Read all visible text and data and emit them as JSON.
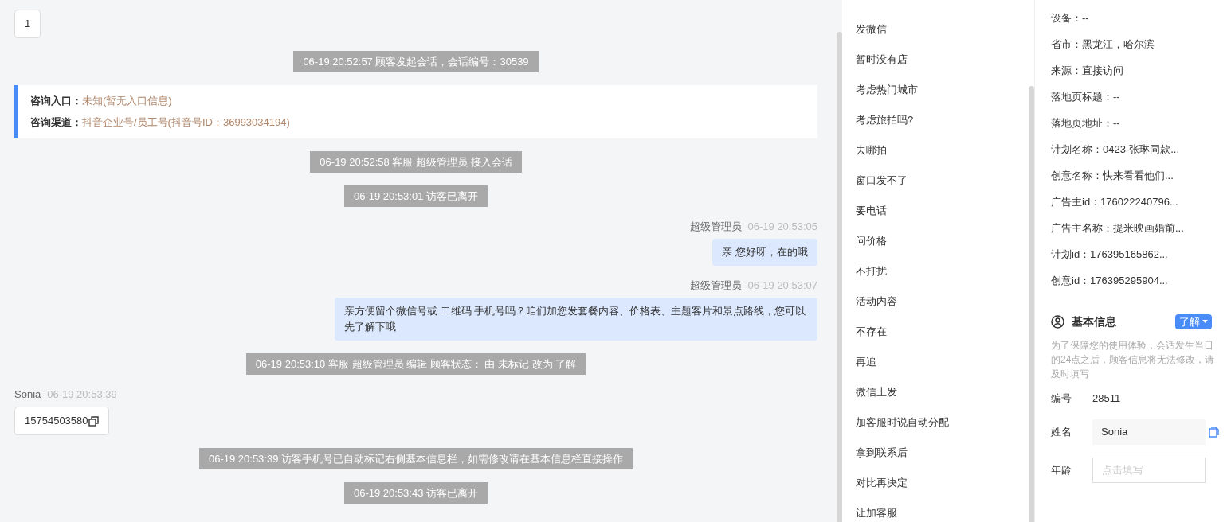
{
  "chat": [
    {
      "kind": "visitor_msg",
      "show_header": false,
      "text": "1"
    },
    {
      "kind": "notice",
      "text": "06-19 20:52:57 顾客发起会话，会话编号：30539"
    },
    {
      "kind": "source_card",
      "lines": [
        {
          "label": "咨询入口：",
          "value": "未知(暂无入口信息)"
        },
        {
          "label": "咨询渠道：",
          "value": "抖音企业号/员工号(抖音号ID：36993034194)"
        }
      ]
    },
    {
      "kind": "notice",
      "text": "06-19 20:52:58 客服 超级管理员 接入会话"
    },
    {
      "kind": "notice",
      "text": "06-19 20:53:01 访客已离开"
    },
    {
      "kind": "agent_msg",
      "sender": "超级管理员",
      "time": "06-19 20:53:05",
      "text": "亲 您好呀，在的哦"
    },
    {
      "kind": "agent_msg",
      "sender": "超级管理员",
      "time": "06-19 20:53:07",
      "text": "亲方便留个微信号或 二维码 手机号吗？咱们加您发套餐内容、价格表、主题客片和景点路线，您可以先了解下哦"
    },
    {
      "kind": "notice",
      "text": "06-19 20:53:10 客服 超级管理员 编辑 顾客状态： 由 未标记 改为 了解"
    },
    {
      "kind": "visitor_msg",
      "show_header": true,
      "sender": "Sonia",
      "time": "06-19 20:53:39",
      "text": "15754503580",
      "copy": true
    },
    {
      "kind": "notice",
      "text": "06-19 20:53:39 访客手机号已自动标记右侧基本信息栏，如需修改请在基本信息栏直接操作"
    },
    {
      "kind": "notice",
      "text": "06-19 20:53:43 访客已离开"
    }
  ],
  "quick_replies": [
    "发微信",
    "暂时没有店",
    "考虑热门城市",
    "考虑旅拍吗?",
    "去哪拍",
    "窗口发不了",
    "要电话",
    "问价格",
    "不打扰",
    "活动内容",
    "不存在",
    "再追",
    "微信上发",
    "加客服时说自动分配",
    "拿到联系后",
    "对比再决定",
    "让加客服"
  ],
  "visitor_info": [
    "设备：--",
    "省市：黑龙江，哈尔滨",
    "来源：直接访问",
    "落地页标题：--",
    "落地页地址：--",
    "计划名称：0423-张琳同款...",
    "创意名称：快来看看他们...",
    "广告主id：176022240796...",
    "广告主名称：提米映画婚前...",
    "计划id：176395165862...",
    "创意id：176395295904..."
  ],
  "basic_info": {
    "title": "基本信息",
    "status": "了解",
    "note": "为了保障您的使用体验，会话发生当日的24点之后，顾客信息将无法修改，请及时填写",
    "fields": [
      {
        "kind": "text",
        "label": "编号",
        "value": "28511"
      },
      {
        "kind": "input",
        "label": "姓名",
        "value": "Sonia"
      },
      {
        "kind": "input",
        "label": "年龄",
        "placeholder": "点击填写"
      }
    ]
  }
}
